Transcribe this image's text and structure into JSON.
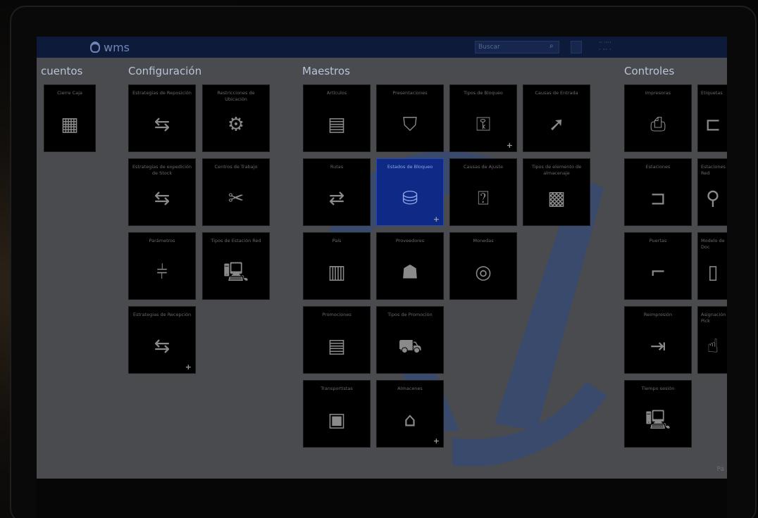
{
  "app": {
    "name": "wms"
  },
  "header": {
    "search_placeholder": "Buscar",
    "user_line1": "·· ····",
    "user_line2": "· ··· ·"
  },
  "sections": {
    "cuentos": "cuentos",
    "configuracion": "Configuración",
    "maestros": "Maestros",
    "controles": "Controles"
  },
  "tiles": {
    "cuentos_cierre": {
      "label": "Cierre Caja",
      "icon": "calculator-icon"
    },
    "conf_estr_reposicion": {
      "label": "Estrategias de Reposición",
      "icon": "strategy-icon"
    },
    "conf_ubicacion": {
      "label": "Restricciones de Ubicación",
      "icon": "location-settings-icon"
    },
    "conf_estr_expedicion": {
      "label": "Estrategias de expedición de Stock",
      "icon": "strategy-icon"
    },
    "conf_centros": {
      "label": "Centros de Trabajo",
      "icon": "tools-icon"
    },
    "conf_parametros": {
      "label": "Parámetros",
      "icon": "sliders-icon"
    },
    "conf_tipos_estacion": {
      "label": "Tipos de Estación Red",
      "icon": "workstation-icon"
    },
    "conf_estr_recepcion": {
      "label": "Estrategias de Recepción",
      "icon": "strategy-icon"
    },
    "m_articulos": {
      "label": "Artículos",
      "icon": "chip-icon"
    },
    "m_presentaciones": {
      "label": "Presentaciones",
      "icon": "bag-icon"
    },
    "m_tipos_bloqueo": {
      "label": "Tipos de Bloqueo",
      "icon": "lock-question-icon"
    },
    "m_causas_entrada": {
      "label": "Causas de Entrada",
      "icon": "entry-question-icon"
    },
    "m_rutas": {
      "label": "Rutas",
      "icon": "transfer-arrows-icon"
    },
    "m_estados_bloqueo": {
      "label": "Estados de Bloqueo",
      "icon": "lock-coins-icon"
    },
    "m_causas_ajuste": {
      "label": "Causas de Ajuste",
      "icon": "adjust-question-icon"
    },
    "m_tipos_almacen": {
      "label": "Tipos de elemento de almacenaje",
      "icon": "storage-grid-icon"
    },
    "m_pais": {
      "label": "País",
      "icon": "buildings-icon"
    },
    "m_proveedores": {
      "label": "Proveedores",
      "icon": "supplier-icon"
    },
    "m_monedas": {
      "label": "Monedas",
      "icon": "coins-icon"
    },
    "m_promociones": {
      "label": "Promociones",
      "icon": "chip-icon"
    },
    "m_tipos_promocion": {
      "label": "Tipos de Promoción",
      "icon": "cart-question-icon"
    },
    "m_transportistas": {
      "label": "Transportistas",
      "icon": "transport-icon"
    },
    "m_almacenes": {
      "label": "Almacenes",
      "icon": "warehouse-icon"
    },
    "c_impresoras": {
      "label": "Impresoras",
      "icon": "printer-icon"
    },
    "c_etiquetas": {
      "label": "Etiquetas",
      "icon": "label-icon"
    },
    "c_estaciones": {
      "label": "Estaciones",
      "icon": "station-icon"
    },
    "c_estaciones_red": {
      "label": "Estaciones Red",
      "icon": "network-icon"
    },
    "c_puertas": {
      "label": "Puertas",
      "icon": "door-icon"
    },
    "c_modelo_doc": {
      "label": "Modelo de Doc",
      "icon": "document-icon"
    },
    "c_reimpresion": {
      "label": "Reimpresión",
      "icon": "reprint-icon"
    },
    "c_asignacion": {
      "label": "Asignación Pick",
      "icon": "hand-icon"
    },
    "c_tiempo_sesion": {
      "label": "Tiempo sesión",
      "icon": "session-monitor-icon"
    }
  },
  "colors": {
    "topbar": "#0d1a3a",
    "selected_tile": "#0e2a86",
    "screen_bg": "#4a4b4f"
  },
  "page_indicator": "Pá"
}
